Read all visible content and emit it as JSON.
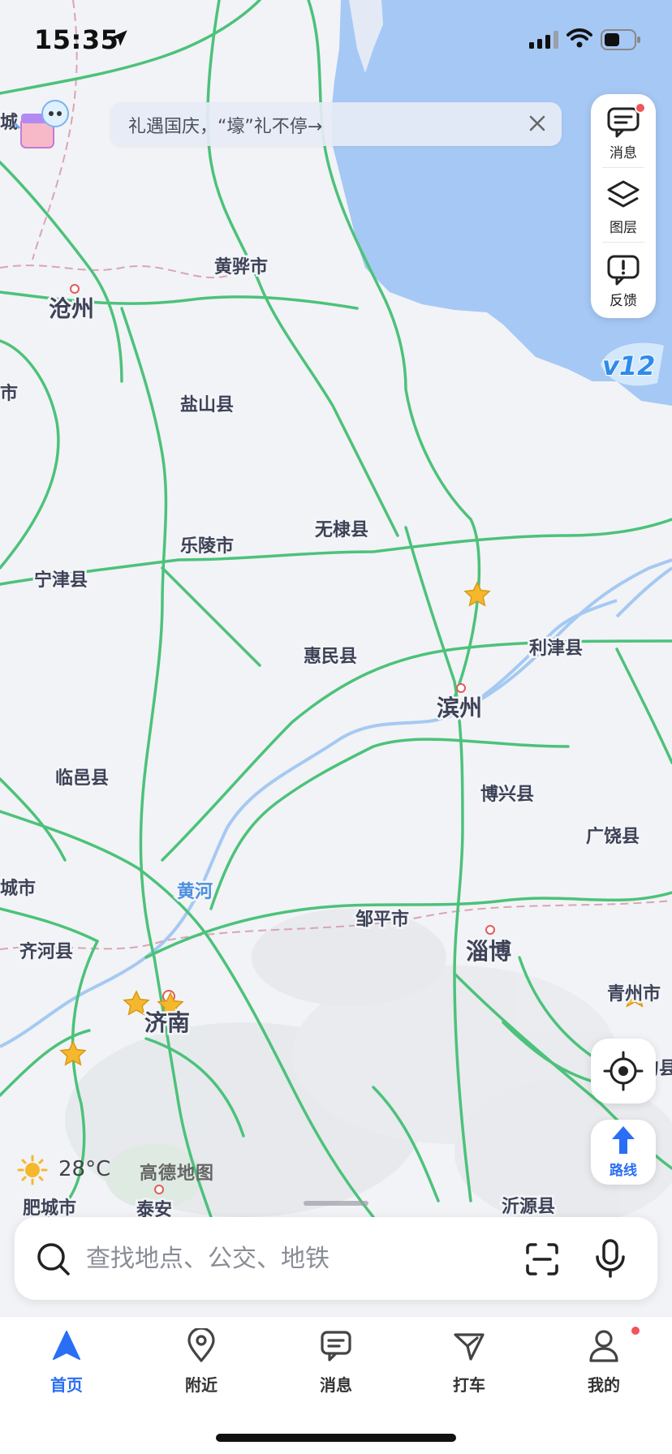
{
  "status_bar": {
    "time": "15:35"
  },
  "colors": {
    "accent": "#2a6ef5",
    "sea": "#a6c8f5",
    "road": "#4cc27a",
    "river": "#a5c9f2",
    "star": "#f5b72e",
    "badge_red": "#f2545b"
  },
  "banner": {
    "text": "礼遇国庆，“壕”礼不停→",
    "close_icon": "close-icon"
  },
  "tools": [
    {
      "label": "消息",
      "icon": "message-icon",
      "has_dot": true
    },
    {
      "label": "图层",
      "icon": "layers-icon"
    },
    {
      "label": "反馈",
      "icon": "feedback-icon"
    }
  ],
  "v12_badge": {
    "text": "v12"
  },
  "map": {
    "cities_major": [
      "沧州",
      "滨州",
      "淄博",
      "济南",
      "泰安"
    ],
    "cities_minor": [
      "黄骅市",
      "盐山县",
      "乐陵市",
      "无棣县",
      "宁津县",
      "惠民县",
      "利津县",
      "临邑县",
      "博兴县",
      "广饶县",
      "城市",
      "齐河县",
      "邹平市",
      "青州市",
      "肥城市",
      "沂源县",
      "城",
      "市",
      "句县"
    ],
    "river": "黄河"
  },
  "route_button": {
    "label": "路线"
  },
  "weather": {
    "temperature": "28°C",
    "icon": "sun-icon"
  },
  "watermark": "高德地图",
  "search": {
    "placeholder": "查找地点、公交、地铁"
  },
  "nav": [
    {
      "label": "首页",
      "icon": "navigate-arrow-icon",
      "active": true
    },
    {
      "label": "附近",
      "icon": "location-pin-icon"
    },
    {
      "label": "消息",
      "icon": "message-icon"
    },
    {
      "label": "打车",
      "icon": "taxi-icon"
    },
    {
      "label": "我的",
      "icon": "person-icon",
      "has_dot": true
    }
  ]
}
